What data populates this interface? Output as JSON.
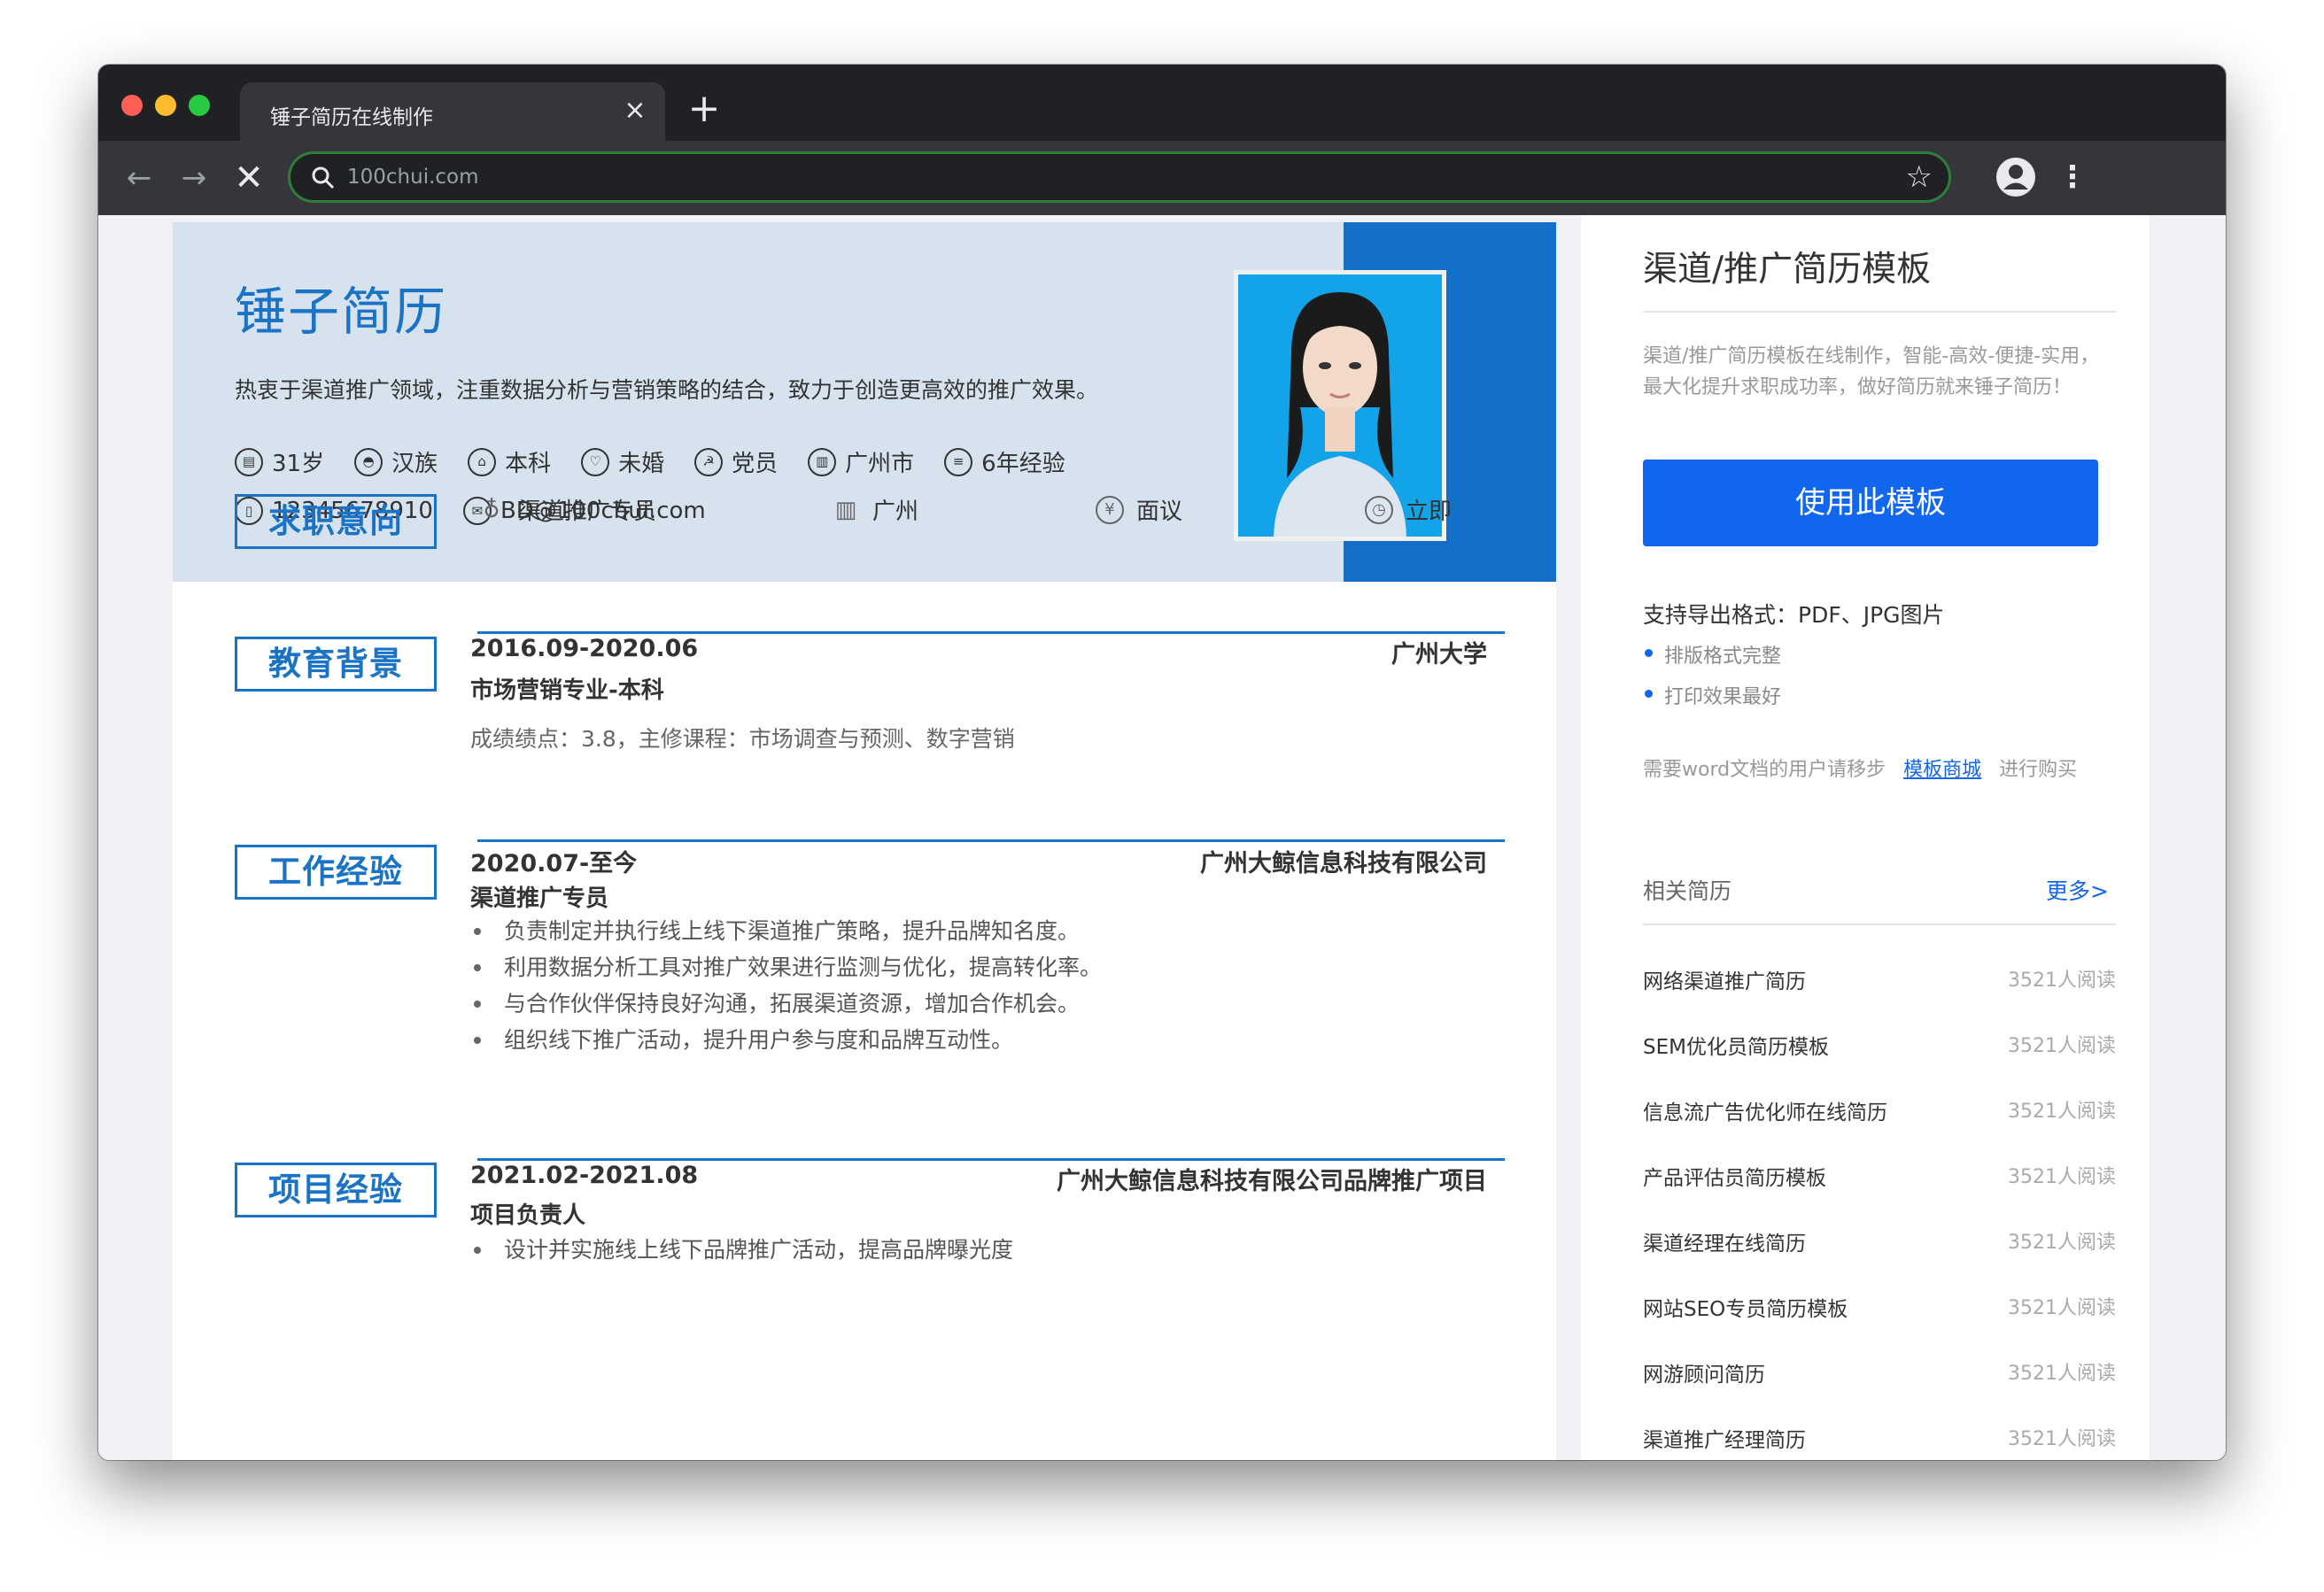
{
  "browser": {
    "tab_title": "锤子简历在线制作",
    "tab_close": "×",
    "new_tab": "+",
    "url": "100chui.com",
    "star": "☆",
    "menu": "⋮",
    "back": "←",
    "forward": "→",
    "stop": "✕"
  },
  "resume": {
    "name": "锤子简历",
    "motto": "热衷于渠道推广领域，注重数据分析与营销策略的结合，致力于创造更高效的推广效果。",
    "info": {
      "age": "31岁",
      "ethnicity": "汉族",
      "degree": "本科",
      "marital": "未婚",
      "political": "党员",
      "city": "广州市",
      "experience": "6年经验",
      "phone": "12345678910",
      "email": "BD@100chui.com"
    },
    "intent": {
      "title": "求职意向",
      "position": "渠道推广专员",
      "location": "广州",
      "salary": "面议",
      "availability": "立即"
    },
    "education": {
      "title": "教育背景",
      "date": "2016.09-2020.06",
      "school": "广州大学",
      "major": "市场营销专业-本科",
      "desc": "成绩绩点：3.8，主修课程：市场调查与预测、数字营销"
    },
    "work": {
      "title": "工作经验",
      "date": "2020.07-至今",
      "company": "广州大鲸信息科技有限公司",
      "role": "渠道推广专员",
      "bullets": [
        "负责制定并执行线上线下渠道推广策略，提升品牌知名度。",
        "利用数据分析工具对推广效果进行监测与优化，提高转化率。",
        "与合作伙伴保持良好沟通，拓展渠道资源，增加合作机会。",
        "组织线下推广活动，提升用户参与度和品牌互动性。"
      ]
    },
    "project": {
      "title": "项目经验",
      "date": "2021.02-2021.08",
      "name": "广州大鲸信息科技有限公司品牌推广项目",
      "role": "项目负责人",
      "bullet_partial": "设计并实施线上线下品牌推广活动，提高品牌曝光度"
    }
  },
  "sidebar": {
    "title": "渠道/推广简历模板",
    "desc": "渠道/推广简历模板在线制作，智能-高效-便捷-实用，最大化提升求职成功率，做好简历就来锤子简历！",
    "use_button": "使用此模板",
    "formats": "支持导出格式：PDF、JPG图片",
    "features": [
      "排版格式完整",
      "打印效果最好"
    ],
    "word_prefix": "需要word文档的用户请移步",
    "word_link": "模板商城",
    "word_suffix": "进行购买",
    "related_title": "相关简历",
    "more": "更多>",
    "related": [
      {
        "name": "网络渠道推广简历",
        "count": "3521人阅读"
      },
      {
        "name": "SEM优化员简历模板",
        "count": "3521人阅读"
      },
      {
        "name": "信息流广告优化师在线简历",
        "count": "3521人阅读"
      },
      {
        "name": "产品评估员简历模板",
        "count": "3521人阅读"
      },
      {
        "name": "渠道经理在线简历",
        "count": "3521人阅读"
      },
      {
        "name": "网站SEO专员简历模板",
        "count": "3521人阅读"
      },
      {
        "name": "网游顾问简历",
        "count": "3521人阅读"
      },
      {
        "name": "渠道推广经理简历",
        "count": "3521人阅读"
      }
    ]
  }
}
